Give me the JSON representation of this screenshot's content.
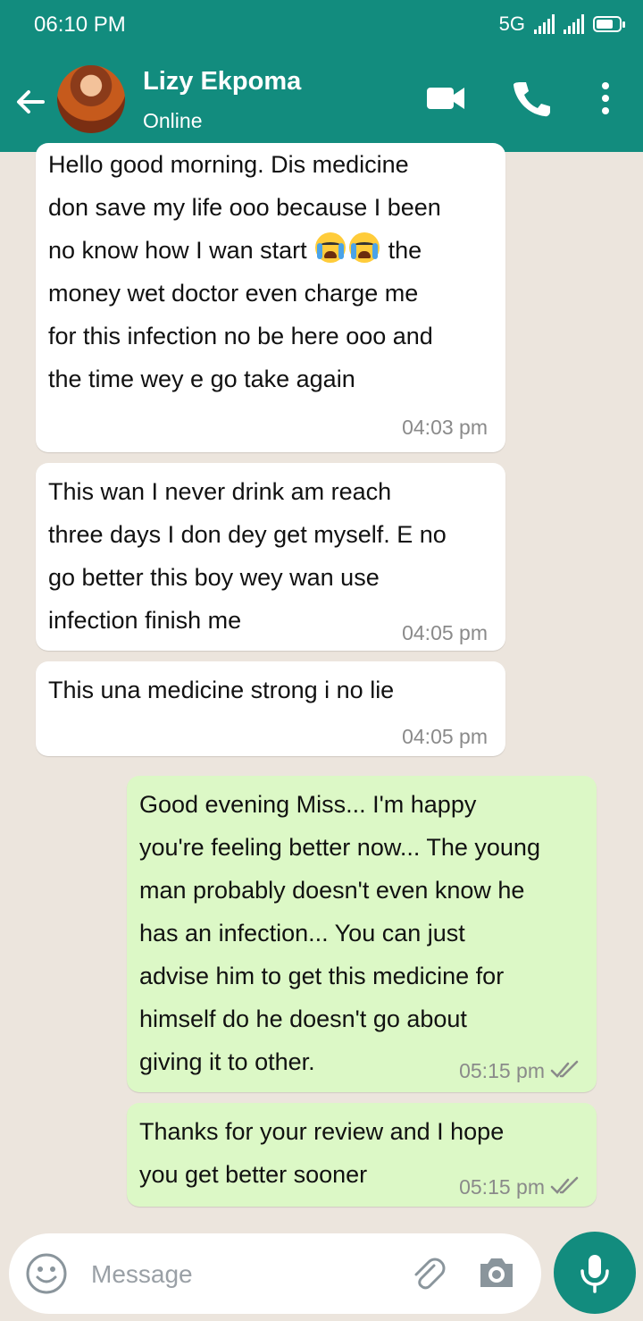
{
  "status_bar": {
    "time": "06:10 PM",
    "network": "5G",
    "battery_level": 0.75
  },
  "header": {
    "name": "Lizy Ekpoma",
    "status": "Online",
    "icons": [
      "back-arrow-icon",
      "video-call-icon",
      "voice-call-icon",
      "more-options-icon"
    ]
  },
  "messages": [
    {
      "direction": "incoming",
      "text_before": " Hello good morning. Dis medicine\ndon save my life ooo because I been\nno know how I wan start ",
      "emoji_count": 2,
      "text_after": " the\nmoney wet doctor even charge me\nfor this infection no be here ooo and\nthe time wey e go take again",
      "time": "04:03 pm"
    },
    {
      "direction": "incoming",
      "text": " This wan I never drink am reach\nthree days I don dey get myself. E no\ngo better this boy wey wan use\ninfection finish me",
      "time": "04:05 pm"
    },
    {
      "direction": "incoming",
      "text": " This una medicine strong i no lie",
      "time": "04:05 pm"
    },
    {
      "direction": "outgoing",
      "text": " Good evening Miss... I'm happy\nyou're feeling better now... The young\nman probably doesn't even know he\nhas an infection... You can just\nadvise him to get this medicine for\nhimself do he doesn't go about\ngiving it to other.",
      "time": "05:15 pm",
      "receipt": "double-tick-icon"
    },
    {
      "direction": "outgoing",
      "text": " Thanks for your review and I hope\nyou get better sooner",
      "time": "05:15 pm",
      "receipt": "double-tick-icon"
    }
  ],
  "input": {
    "placeholder": "Message",
    "value": ""
  },
  "colors": {
    "header": "#128c7e",
    "incoming_bubble": "#ffffff",
    "outgoing_bubble": "#dcf8c6",
    "chat_background": "#ece5dd"
  }
}
